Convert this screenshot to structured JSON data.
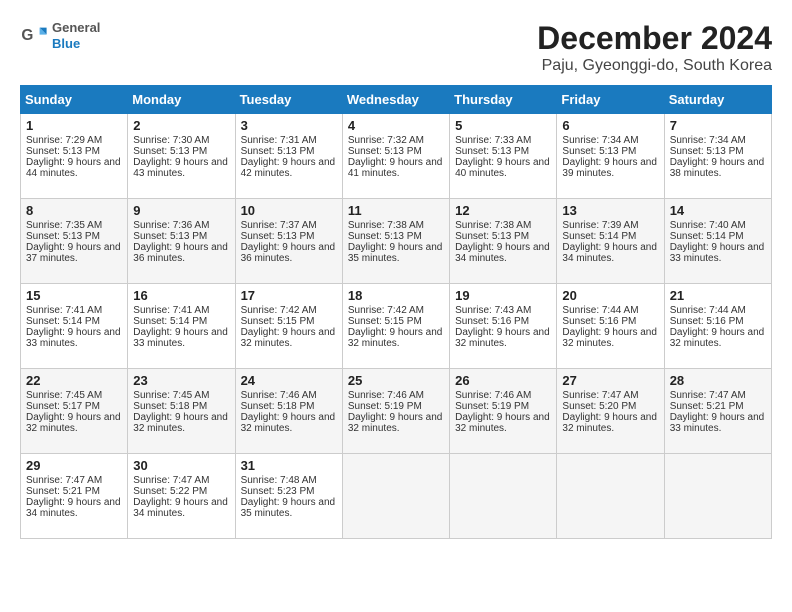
{
  "logo": {
    "line1": "General",
    "line2": "Blue"
  },
  "title": "December 2024",
  "subtitle": "Paju, Gyeonggi-do, South Korea",
  "headers": [
    "Sunday",
    "Monday",
    "Tuesday",
    "Wednesday",
    "Thursday",
    "Friday",
    "Saturday"
  ],
  "weeks": [
    [
      {
        "day": "1",
        "sunrise": "7:29 AM",
        "sunset": "5:13 PM",
        "daylight": "9 hours and 44 minutes."
      },
      {
        "day": "2",
        "sunrise": "7:30 AM",
        "sunset": "5:13 PM",
        "daylight": "9 hours and 43 minutes."
      },
      {
        "day": "3",
        "sunrise": "7:31 AM",
        "sunset": "5:13 PM",
        "daylight": "9 hours and 42 minutes."
      },
      {
        "day": "4",
        "sunrise": "7:32 AM",
        "sunset": "5:13 PM",
        "daylight": "9 hours and 41 minutes."
      },
      {
        "day": "5",
        "sunrise": "7:33 AM",
        "sunset": "5:13 PM",
        "daylight": "9 hours and 40 minutes."
      },
      {
        "day": "6",
        "sunrise": "7:34 AM",
        "sunset": "5:13 PM",
        "daylight": "9 hours and 39 minutes."
      },
      {
        "day": "7",
        "sunrise": "7:34 AM",
        "sunset": "5:13 PM",
        "daylight": "9 hours and 38 minutes."
      }
    ],
    [
      {
        "day": "8",
        "sunrise": "7:35 AM",
        "sunset": "5:13 PM",
        "daylight": "9 hours and 37 minutes."
      },
      {
        "day": "9",
        "sunrise": "7:36 AM",
        "sunset": "5:13 PM",
        "daylight": "9 hours and 36 minutes."
      },
      {
        "day": "10",
        "sunrise": "7:37 AM",
        "sunset": "5:13 PM",
        "daylight": "9 hours and 36 minutes."
      },
      {
        "day": "11",
        "sunrise": "7:38 AM",
        "sunset": "5:13 PM",
        "daylight": "9 hours and 35 minutes."
      },
      {
        "day": "12",
        "sunrise": "7:38 AM",
        "sunset": "5:13 PM",
        "daylight": "9 hours and 34 minutes."
      },
      {
        "day": "13",
        "sunrise": "7:39 AM",
        "sunset": "5:14 PM",
        "daylight": "9 hours and 34 minutes."
      },
      {
        "day": "14",
        "sunrise": "7:40 AM",
        "sunset": "5:14 PM",
        "daylight": "9 hours and 33 minutes."
      }
    ],
    [
      {
        "day": "15",
        "sunrise": "7:41 AM",
        "sunset": "5:14 PM",
        "daylight": "9 hours and 33 minutes."
      },
      {
        "day": "16",
        "sunrise": "7:41 AM",
        "sunset": "5:14 PM",
        "daylight": "9 hours and 33 minutes."
      },
      {
        "day": "17",
        "sunrise": "7:42 AM",
        "sunset": "5:15 PM",
        "daylight": "9 hours and 32 minutes."
      },
      {
        "day": "18",
        "sunrise": "7:42 AM",
        "sunset": "5:15 PM",
        "daylight": "9 hours and 32 minutes."
      },
      {
        "day": "19",
        "sunrise": "7:43 AM",
        "sunset": "5:16 PM",
        "daylight": "9 hours and 32 minutes."
      },
      {
        "day": "20",
        "sunrise": "7:44 AM",
        "sunset": "5:16 PM",
        "daylight": "9 hours and 32 minutes."
      },
      {
        "day": "21",
        "sunrise": "7:44 AM",
        "sunset": "5:16 PM",
        "daylight": "9 hours and 32 minutes."
      }
    ],
    [
      {
        "day": "22",
        "sunrise": "7:45 AM",
        "sunset": "5:17 PM",
        "daylight": "9 hours and 32 minutes."
      },
      {
        "day": "23",
        "sunrise": "7:45 AM",
        "sunset": "5:18 PM",
        "daylight": "9 hours and 32 minutes."
      },
      {
        "day": "24",
        "sunrise": "7:46 AM",
        "sunset": "5:18 PM",
        "daylight": "9 hours and 32 minutes."
      },
      {
        "day": "25",
        "sunrise": "7:46 AM",
        "sunset": "5:19 PM",
        "daylight": "9 hours and 32 minutes."
      },
      {
        "day": "26",
        "sunrise": "7:46 AM",
        "sunset": "5:19 PM",
        "daylight": "9 hours and 32 minutes."
      },
      {
        "day": "27",
        "sunrise": "7:47 AM",
        "sunset": "5:20 PM",
        "daylight": "9 hours and 32 minutes."
      },
      {
        "day": "28",
        "sunrise": "7:47 AM",
        "sunset": "5:21 PM",
        "daylight": "9 hours and 33 minutes."
      }
    ],
    [
      {
        "day": "29",
        "sunrise": "7:47 AM",
        "sunset": "5:21 PM",
        "daylight": "9 hours and 34 minutes."
      },
      {
        "day": "30",
        "sunrise": "7:47 AM",
        "sunset": "5:22 PM",
        "daylight": "9 hours and 34 minutes."
      },
      {
        "day": "31",
        "sunrise": "7:48 AM",
        "sunset": "5:23 PM",
        "daylight": "9 hours and 35 minutes."
      },
      null,
      null,
      null,
      null
    ]
  ]
}
